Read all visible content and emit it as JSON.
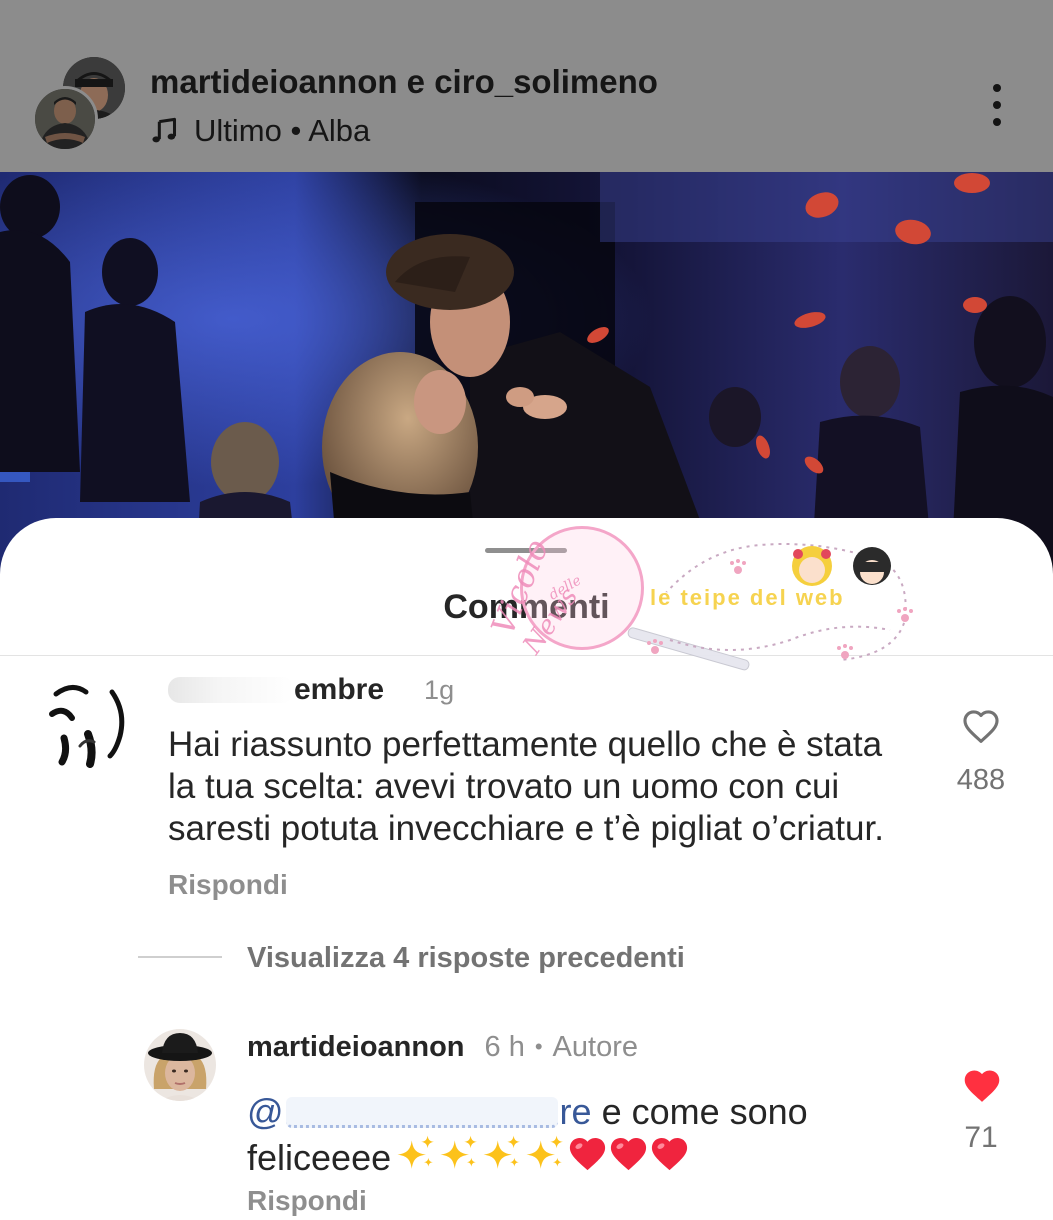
{
  "header": {
    "authors": "martideioannon e ciro_solimeno",
    "audio_icon": "music-note-icon",
    "audio": "Ultimo • Alba",
    "menu_icon": "more-vertical-icon"
  },
  "sheet": {
    "title": "Commenti"
  },
  "comments": [
    {
      "username_visible": "embre",
      "time": "1g",
      "lines": [
        "Hai riassunto perfettamente quello che è stata",
        "la tua scelta: avevi trovato un uomo con cui",
        "saresti potuta invecchiare e t’è pigliat o’criatur."
      ],
      "reply_label": "Rispondi",
      "like_icon": "heart-outline-icon",
      "likes": "488"
    }
  ],
  "view_replies": "Visualizza 4 risposte precedenti",
  "reply": {
    "username": "martideioannon",
    "time": "6 h",
    "separator": "•",
    "badge": "Autore",
    "mention_start": "@",
    "mention_end": "re",
    "text": "e come sono",
    "text_line2": "feliceeee",
    "emoji_icons": [
      "sparkles-emoji-icon",
      "sparkles-emoji-icon",
      "sparkles-emoji-icon",
      "sparkles-emoji-icon",
      "red-heart-emoji-icon",
      "red-heart-emoji-icon",
      "red-heart-emoji-icon"
    ],
    "like_icon": "heart-filled-icon",
    "likes": "71",
    "reply_label": "Rispondi"
  },
  "watermarks": {
    "circle_logo": [
      "Vicolo",
      "delle",
      "News"
    ],
    "banner_logo": "le teipe del web"
  },
  "colors": {
    "liked_red": "#ff3040",
    "mention_blue": "#385898",
    "primary_text": "#262626",
    "secondary_text": "#737373",
    "overlay_gray": "#8c8c8c"
  }
}
